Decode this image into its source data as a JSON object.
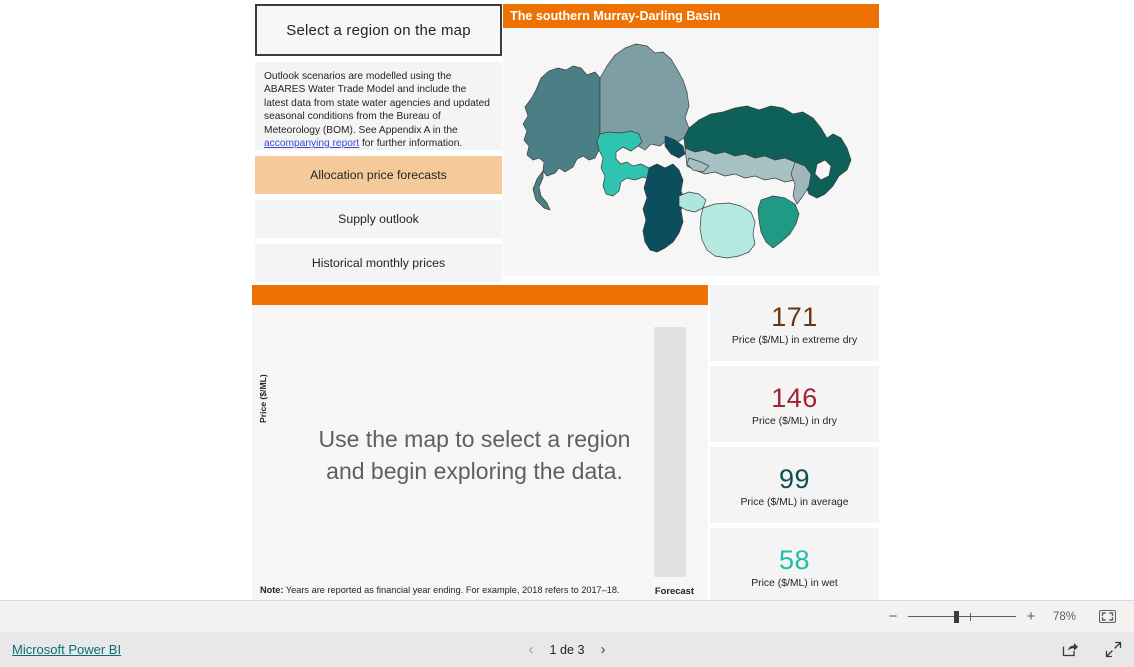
{
  "left_panel": {
    "title": "Select a region on the map",
    "description_parts": {
      "before": "Outlook scenarios are modelled using the ABARES Water Trade Model and include the latest data from state water agencies and updated seasonal conditions from the Bureau of Meteorology (BOM). See Appendix A in the ",
      "link": "accompanying report",
      "after": " for further information."
    },
    "nav_buttons": [
      {
        "label": "Allocation price forecasts",
        "active": true
      },
      {
        "label": "Supply outlook",
        "active": false
      },
      {
        "label": "Historical monthly prices",
        "active": false
      }
    ]
  },
  "map_panel": {
    "header_title": "The southern Murray-Darling Basin",
    "header_color": "#ed7203",
    "region_colors": [
      "#4a7f86",
      "#7d9ea3",
      "#2ec4b0",
      "#0d6158",
      "#0b4f5e",
      "#a7c0c3",
      "#aee5de",
      "#1f9b85",
      "#0f7a6d",
      "#9fb7ba"
    ]
  },
  "chart_panel": {
    "header_color": "#ed7203",
    "y_axis_label": "Price ($/ML)",
    "placeholder_message": "Use the map to select a region and begin exploring the data.",
    "forecast_label": "Forecast",
    "note_prefix": "Note:",
    "note_text": " Years are reported as financial year ending. For example, 2018 refers to 2017–18."
  },
  "kpi_cards": [
    {
      "value": "171",
      "label": "Price ($/ML) in extreme dry",
      "color": "#6b3410"
    },
    {
      "value": "146",
      "label": "Price ($/ML) in dry",
      "color": "#a32035"
    },
    {
      "value": "99",
      "label": "Price ($/ML) in average",
      "color": "#0d4f52"
    },
    {
      "value": "58",
      "label": "Price ($/ML) in wet",
      "color": "#19bfa8"
    }
  ],
  "status_bar": {
    "zoom_minus": "−",
    "zoom_plus": "+",
    "zoom_percent": "78%"
  },
  "footer": {
    "brand": "Microsoft Power BI",
    "prev_arrow": "‹",
    "page_text": "1 de 3",
    "next_arrow": "›"
  }
}
